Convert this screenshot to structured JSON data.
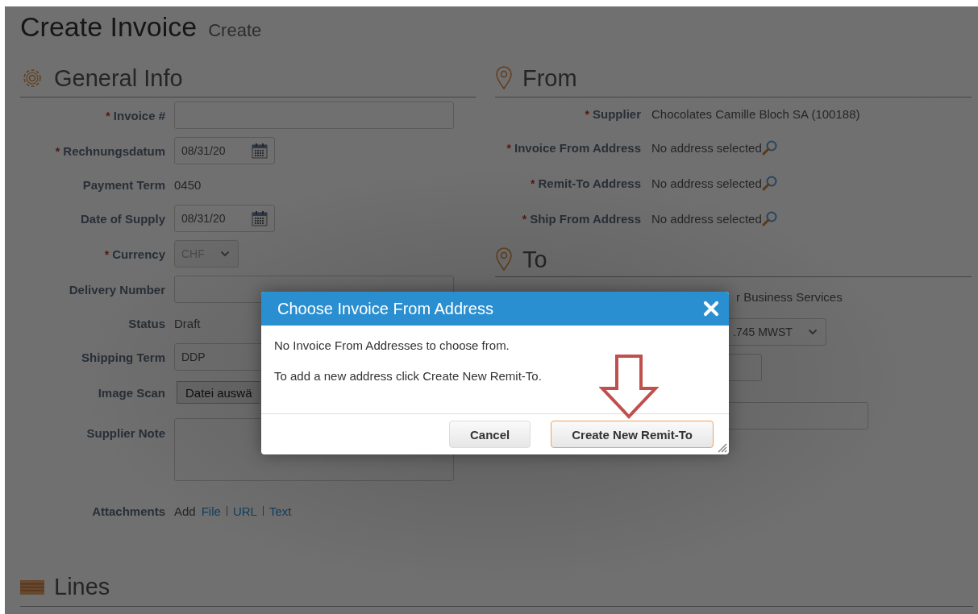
{
  "page": {
    "title": "Create Invoice",
    "subtitle": "Create"
  },
  "general_info": {
    "heading": "General Info",
    "fields": [
      {
        "kind": "input",
        "marker": "*",
        "label": "Invoice #"
      },
      {
        "kind": "date",
        "marker": "*",
        "label": "Rechnungsdatum",
        "value": "08/31/20"
      },
      {
        "kind": "text",
        "label": "Payment Term",
        "value": "0450"
      },
      {
        "kind": "date",
        "label": "Date of Supply",
        "value": "08/31/20"
      },
      {
        "kind": "select",
        "marker": "*",
        "label": "Currency",
        "value": "CHF",
        "disabled": true
      },
      {
        "kind": "input",
        "label": "Delivery Number"
      },
      {
        "kind": "text",
        "label": "Status",
        "value": "Draft"
      },
      {
        "kind": "input",
        "label": "Shipping Term",
        "value": "DDP"
      },
      {
        "kind": "file",
        "label": "Image Scan",
        "button": "Datei auswä"
      },
      {
        "kind": "textarea",
        "label": "Supplier Note"
      },
      {
        "kind": "links",
        "label": "Attachments",
        "prefix": "Add",
        "links": [
          "File",
          "URL",
          "Text"
        ]
      }
    ]
  },
  "from": {
    "heading": "From",
    "fields": [
      {
        "kind": "text",
        "marker": "*",
        "label": "Supplier",
        "value": "Chocolates Camille Bloch SA (100188)"
      },
      {
        "kind": "lookup",
        "marker": "*",
        "label": "Invoice From Address",
        "value": "No address selected"
      },
      {
        "kind": "lookup",
        "marker": "*",
        "label": "Remit-To Address",
        "value": "No address selected"
      },
      {
        "kind": "lookup",
        "marker": "*",
        "label": "Ship From Address",
        "value": "No address selected"
      }
    ]
  },
  "to": {
    "heading": "To",
    "fields": [
      {
        "kind": "text",
        "value": "r Business Services"
      },
      {
        "kind": "select",
        "value": ".745 MWST"
      },
      {
        "kind": "input",
        "wide": false
      },
      {
        "kind": "input",
        "wide": true
      }
    ]
  },
  "lines": {
    "heading": "Lines"
  },
  "dialog": {
    "title": "Choose Invoice From Address",
    "messages": [
      "No Invoice From Addresses to choose from.",
      "To add a new address click Create New Remit-To."
    ],
    "buttons": [
      {
        "label": "Cancel",
        "primary": false
      },
      {
        "label": "Create New Remit-To",
        "primary": true
      }
    ]
  }
}
